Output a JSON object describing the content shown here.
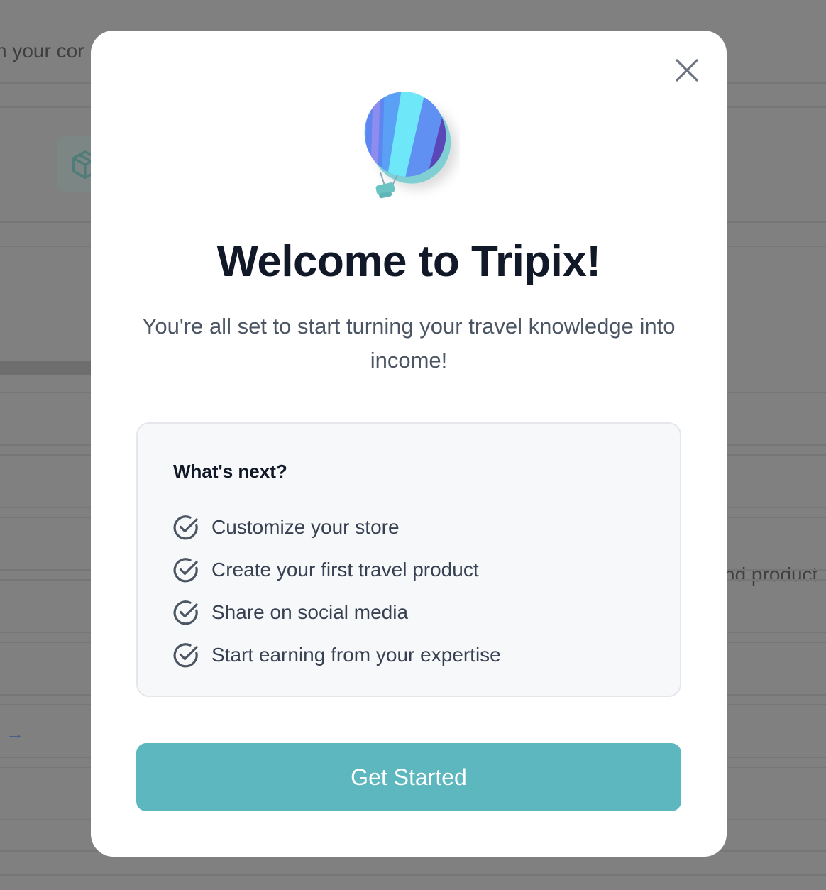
{
  "background": {
    "left_text": "h your cor",
    "right_text": "nd product"
  },
  "modal": {
    "close_label": "Close",
    "title": "Welcome to Tripix!",
    "subtitle": "You're all set to start turning your travel knowledge into income!",
    "next_steps": {
      "heading": "What's next?",
      "items": [
        "Customize your store",
        "Create your first travel product",
        "Share on social media",
        "Start earning from your expertise"
      ]
    },
    "cta_label": "Get Started"
  },
  "icons": {
    "close": "close-icon",
    "logo": "hot-air-balloon-icon",
    "check": "check-circle-icon",
    "bg_package": "package-icon",
    "bg_arrow": "arrow-right-icon"
  },
  "colors": {
    "accent": "#5db7bf",
    "title": "#111827",
    "body_text": "#4b5563",
    "card_bg": "#f7f8fa",
    "overlay": "#808080"
  }
}
